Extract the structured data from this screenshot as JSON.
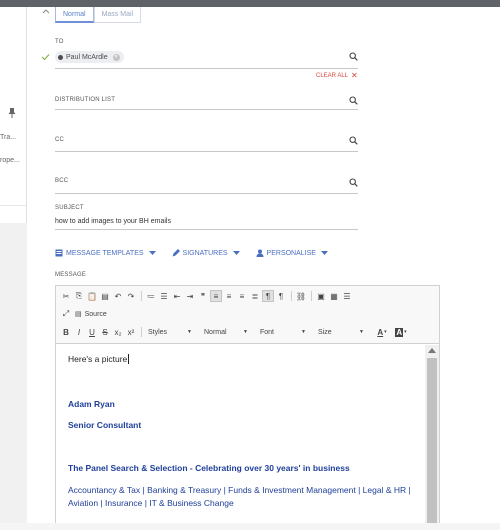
{
  "left_pane": {
    "item1": "Tra...",
    "item2": "rope..."
  },
  "compose": {
    "modes": [
      "Normal",
      "Mass Mail"
    ],
    "to": {
      "label": "TO",
      "recipient": "Paul McArdle",
      "clear_all": "CLEAR ALL"
    },
    "distribution_list": {
      "label": "DISTRIBUTION LIST"
    },
    "cc": {
      "label": "CC"
    },
    "bcc": {
      "label": "BCC"
    },
    "subject": {
      "label": "SUBJECT",
      "value": "how to add images to your BH emails"
    },
    "menus": [
      "MESSAGE TEMPLATES",
      "SIGNATURES",
      "PERSONALISE"
    ],
    "message_label": "MESSAGE"
  },
  "editor": {
    "source_label": "Source",
    "combos": {
      "styles": "Styles",
      "format": "Normal",
      "font": "Font",
      "size": "Size"
    },
    "content": {
      "line1": "Here's a picture",
      "name": "Adam Ryan",
      "title": "Senior Consultant",
      "company": "The Panel Search & Selection - Celebrating over 30 years' in business",
      "practices1": "Accountancy & Tax | Banking & Treasury | Funds & Investment Management | Legal & HR |",
      "practices2": "Aviation | Insurance | IT & Business Change"
    }
  },
  "colors": {
    "accent": "#4a6fc0",
    "clear": "#d9453b",
    "signature": "#1f3f99"
  }
}
